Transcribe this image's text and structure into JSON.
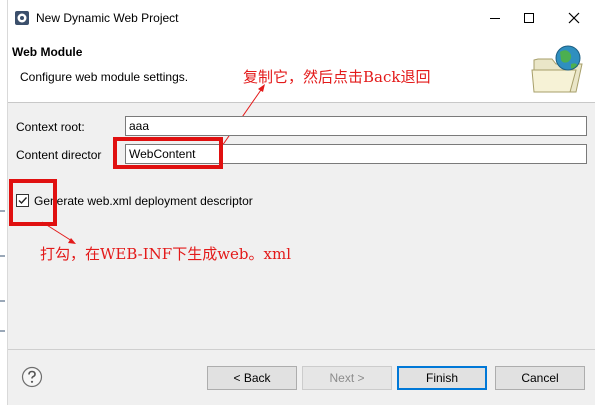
{
  "window": {
    "title": "New Dynamic Web Project",
    "app_icon": "eclipse-gear-icon",
    "controls": [
      "minimize-icon",
      "maximize-icon",
      "close-icon"
    ]
  },
  "banner": {
    "title": "Web Module",
    "description": "Configure web module settings.",
    "image_icon": "folder-globe-icon"
  },
  "form": {
    "context_root": {
      "label": "Context root:",
      "value": "aaa"
    },
    "content_directory": {
      "label": "Content director",
      "value": "WebContent"
    }
  },
  "checkbox": {
    "checked": true,
    "label": "Generate web.xml deployment descriptor"
  },
  "annotations": {
    "copy_note": "复制它，然后点击Back退回",
    "check_note": "打勾，在WEB-INF下生成web。xml"
  },
  "footer": {
    "help_icon": "help-question-icon",
    "back": "< Back",
    "next": "Next >",
    "finish": "Finish",
    "cancel": "Cancel"
  },
  "colors": {
    "annotation_red": "#e31a1a",
    "accent_blue": "#0078d7"
  }
}
